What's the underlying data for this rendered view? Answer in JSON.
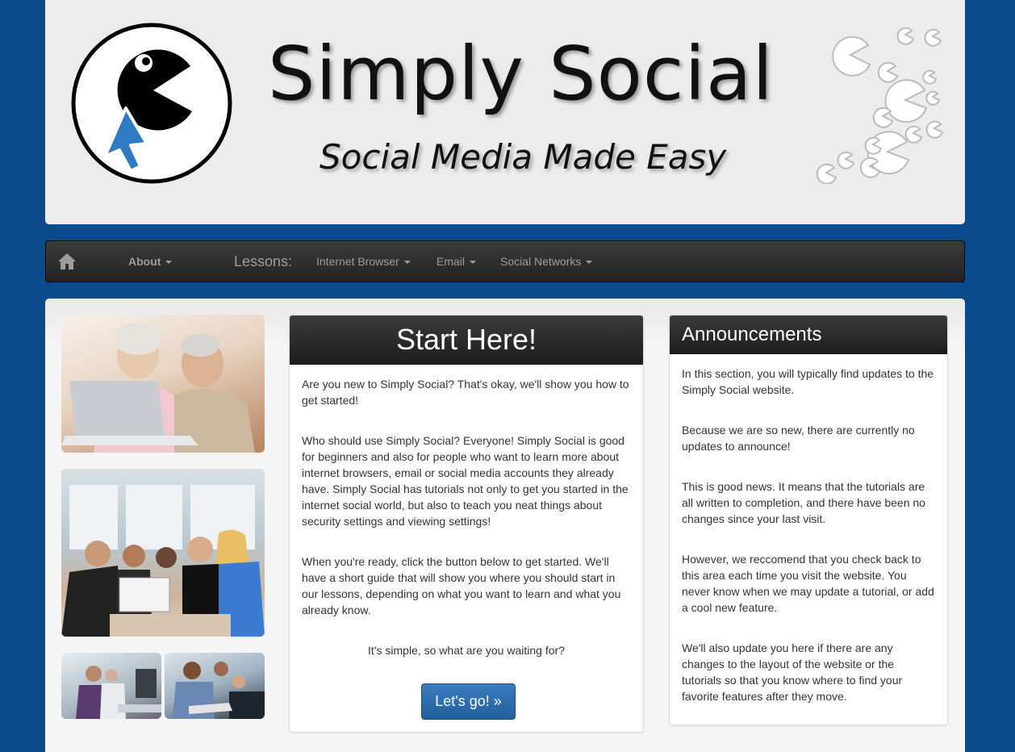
{
  "header": {
    "title": "Simply Social",
    "tagline": "Social Media Made Easy"
  },
  "navbar": {
    "home_icon": "home-icon",
    "about_label": "About",
    "lessons_label": "Lessons:",
    "items": [
      {
        "label": "Internet Browser"
      },
      {
        "label": "Email"
      },
      {
        "label": "Social Networks"
      }
    ]
  },
  "start_panel": {
    "heading": "Start Here!",
    "paragraphs": [
      "Are you new to Simply Social? That's okay, we'll show you how to get started!",
      "Who should use Simply Social? Everyone! Simply Social is good for beginners and also for people who want to learn more about internet browsers, email or social media accounts they already have. Simply Social has tutorials not only to get you started in the internet social world, but also to teach you neat things about security settings and viewing settings!",
      "When you're ready, click the button below to get started. We'll have a short guide that will show you where you should start in our lessons, depending on what you want to learn and what you already know.",
      "It's simple, so what are you waiting for?"
    ],
    "button_label": "Let's go! »"
  },
  "announcements": {
    "heading": "Announcements",
    "paragraphs": [
      "In this section, you will typically find updates to the Simply Social website.",
      "Because we are so new, there are currently no updates to announce!",
      "This is good news. It means that the tutorials are all written to completion, and there have been no changes since your last visit.",
      "However, we reccomend that you check back to this area each time you visit the website. You never know when we may update a tutorial, or add a cool new feature.",
      "We'll also update you here if there are any changes to the layout of the website or the tutorials so that you know where to find your favorite features after they move."
    ]
  },
  "colors": {
    "page_background": "#0b4a8b",
    "navbar": "#222222",
    "button": "#2a6aad",
    "panel_header": "#222222"
  }
}
